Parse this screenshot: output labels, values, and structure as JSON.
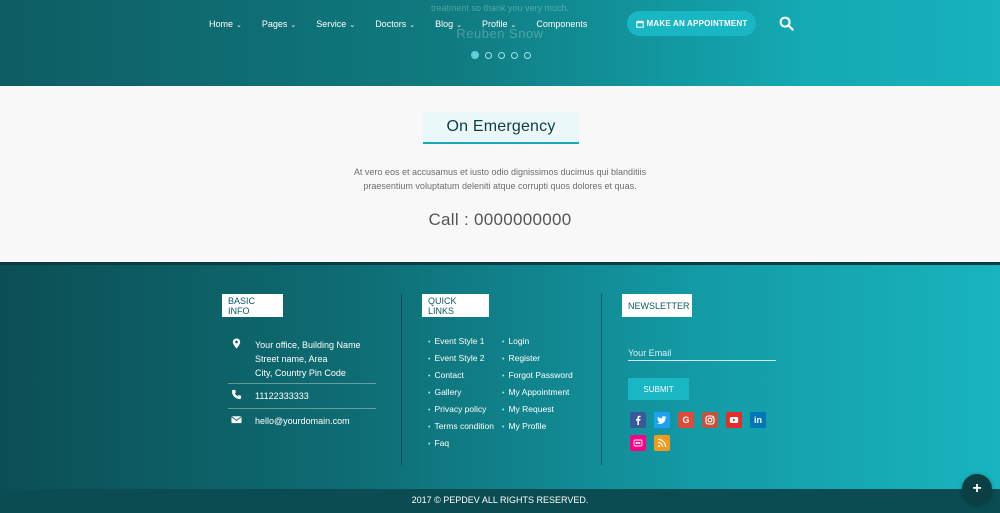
{
  "hero": {
    "testimonial_text": "treatment so thank you very much.",
    "testimonial_author": "Reuben Snow",
    "nav": [
      {
        "label": "Home",
        "has_dropdown": true
      },
      {
        "label": "Pages",
        "has_dropdown": true
      },
      {
        "label": "Service",
        "has_dropdown": true
      },
      {
        "label": "Doctors",
        "has_dropdown": true
      },
      {
        "label": "Blog",
        "has_dropdown": true
      },
      {
        "label": "Profile",
        "has_dropdown": true
      },
      {
        "label": "Components",
        "has_dropdown": false
      }
    ],
    "appointment_label": "MAKE AN APPOINTMENT",
    "appointment_icon": "calendar-icon",
    "search_icon": "search-icon",
    "slider_dots": 5,
    "active_dot": 0
  },
  "emergency": {
    "title": "On Emergency",
    "text_line1": "At vero eos et accusamus et iusto odio dignissimos ducimus qui blanditiis",
    "text_line2": "praesentium voluptatum deleniti atque corrupti quos dolores et quas.",
    "call": "Call : 0000000000"
  },
  "footer": {
    "basic_info": {
      "heading": "BASIC INFO",
      "address_line1": "Your office, Building Name",
      "address_line2": "Street name, Area",
      "address_line3": "City, Country Pin Code",
      "phone": "11122333333",
      "email": "hello@yourdomain.com"
    },
    "quick_links": {
      "heading": "QUICK LINKS",
      "col1": [
        "Event Style 1",
        "Event Style 2",
        "Contact",
        "Gallery",
        "Privacy policy",
        "Terms condition",
        "Faq"
      ],
      "col2": [
        "Login",
        "Register",
        "Forgot Password",
        "My Appointment",
        "My Request",
        "My Profile"
      ]
    },
    "newsletter": {
      "heading": "NEWSLETTER",
      "email_placeholder": "Your Email",
      "submit_label": "SUBMIT",
      "socials": [
        {
          "name": "facebook-icon",
          "color": "#3b5998"
        },
        {
          "name": "twitter-icon",
          "color": "#1da1f2"
        },
        {
          "name": "google-plus-icon",
          "color": "#dd4b39"
        },
        {
          "name": "instagram-icon",
          "color": "#c1543f"
        },
        {
          "name": "youtube-icon",
          "color": "#e52d27"
        },
        {
          "name": "linkedin-icon",
          "color": "#0077b5"
        },
        {
          "name": "flickr-icon",
          "color": "#ff0084"
        },
        {
          "name": "rss-icon",
          "color": "#f39a1d"
        }
      ]
    },
    "copyright": "2017 © PEPDEV ALL RIGHTS RESERVED.",
    "fab_icon": "plus-icon"
  }
}
